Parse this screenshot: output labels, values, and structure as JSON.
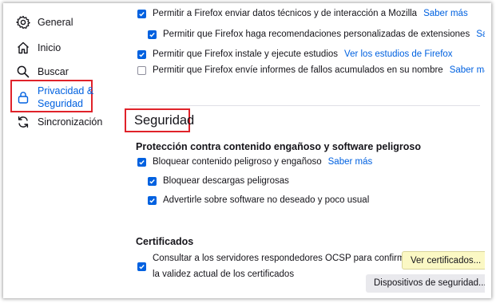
{
  "sidebar": {
    "items": [
      {
        "label": "General",
        "icon": "gear-icon"
      },
      {
        "label": "Inicio",
        "icon": "home-icon"
      },
      {
        "label": "Buscar",
        "icon": "search-icon"
      },
      {
        "label_line1": "Privacidad &",
        "label_line2": "Seguridad",
        "icon": "lock-icon",
        "active": true
      },
      {
        "label": "Sincronización",
        "icon": "sync-icon"
      }
    ]
  },
  "data_collection": {
    "row1_text": "Permitir a Firefox enviar datos técnicos y de interacción a Mozilla",
    "row1_link": "Saber más",
    "row2_text": "Permitir que Firefox haga recomendaciones personalizadas de extensiones",
    "row2_link": "Saber más",
    "row3_text": "Permitir que Firefox instale y ejecute estudios",
    "row3_link": "Ver los estudios de Firefox",
    "row4_text": "Permitir que Firefox envíe informes de fallos acumulados en su nombre",
    "row4_link": "Saber más"
  },
  "security": {
    "title": "Seguridad",
    "deceptive_heading": "Protección contra contenido engañoso y software peligroso",
    "block_dangerous": "Bloquear contenido peligroso y engañoso",
    "block_dangerous_link": "Saber más",
    "block_downloads": "Bloquear descargas peligrosas",
    "warn_unwanted": "Advertirle sobre software no deseado y poco usual"
  },
  "certificates": {
    "heading": "Certificados",
    "ocsp_line1": "Consultar a los servidores respondedores OCSP para confirmar",
    "ocsp_line2": "la validez actual de los certificados",
    "view_button": "Ver certificados...",
    "devices_button": "Dispositivos de seguridad..."
  },
  "colors": {
    "accent": "#0061e0",
    "annotation_red": "#e0222a",
    "highlight_yellow": "#fbf8c4"
  }
}
